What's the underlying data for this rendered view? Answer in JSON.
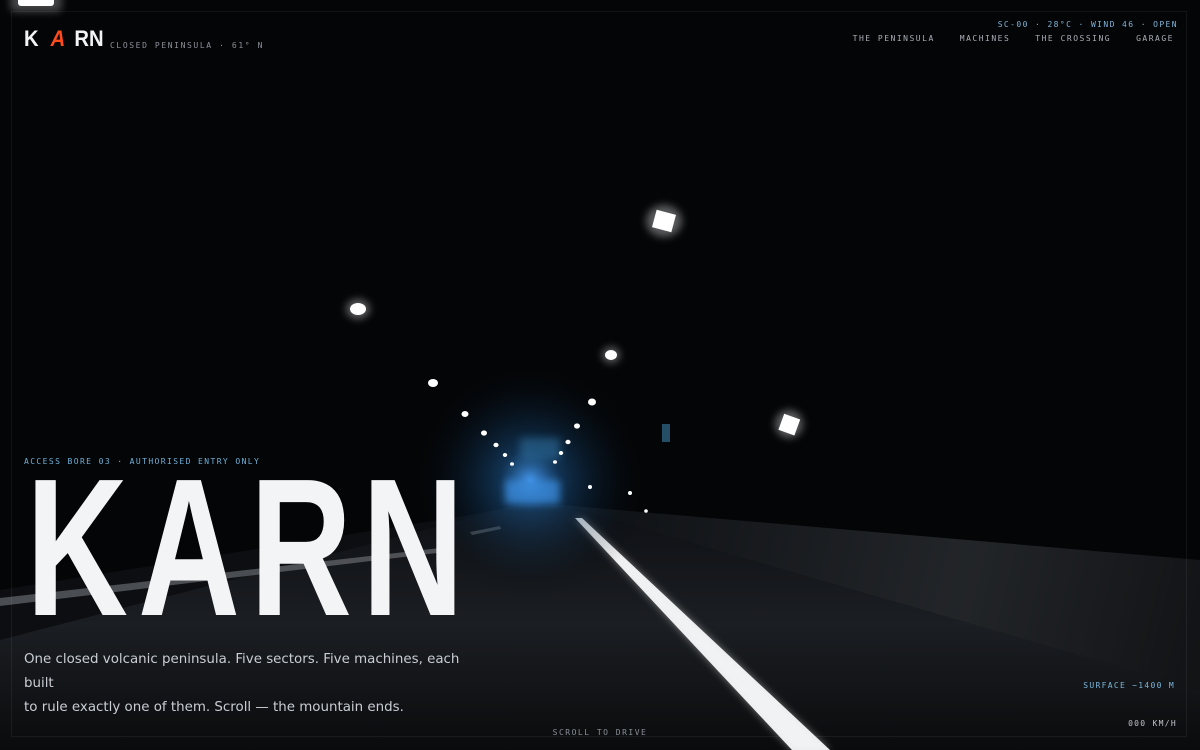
{
  "brand": {
    "logo_letters": [
      "K",
      "A",
      "RN"
    ],
    "tagline": "CLOSED PENINSULA · 61° N",
    "accent_color": "#ff4a1c"
  },
  "status": {
    "text": "SC-00 · 28°C · WIND 46 · OPEN"
  },
  "nav": {
    "items": [
      "THE PENINSULA",
      "MACHINES",
      "THE CROSSING",
      "GARAGE"
    ]
  },
  "hero": {
    "eyebrow": "ACCESS BORE 03 · AUTHORISED ENTRY ONLY",
    "title": "KARN",
    "copy_line1": "One closed volcanic peninsula. Five sectors. Five machines, each built",
    "copy_line2": "to rule exactly one of them. Scroll — the mountain ends."
  },
  "footer": {
    "scroll_cue": "SCROLL TO DRIVE",
    "surface": "SURFACE −1400 M",
    "speed": "000 KM/H"
  },
  "background": {
    "scene": "tunnel-road-night",
    "light_color": "#ffffff",
    "tunnel_glow_color": "#2a7fd0"
  }
}
